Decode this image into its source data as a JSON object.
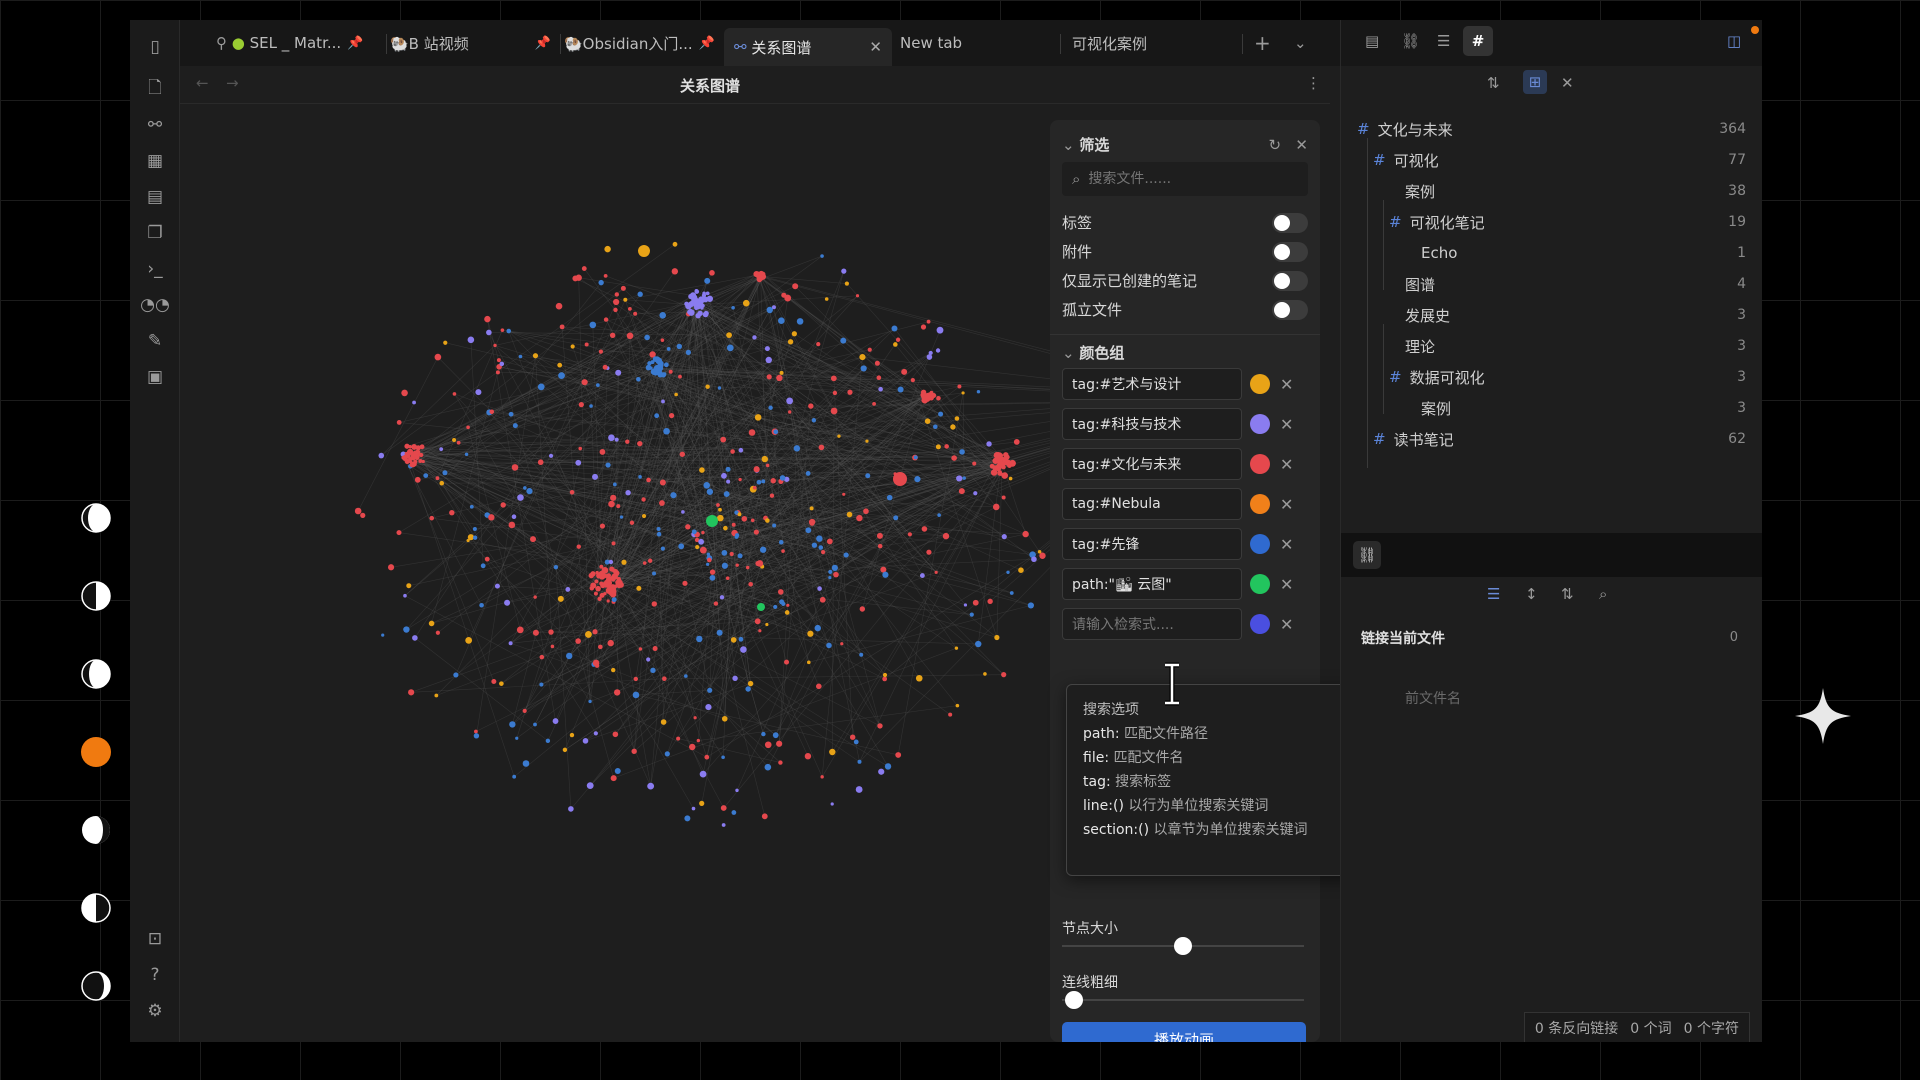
{
  "tabs": [
    {
      "label": "SEL _ Matr...",
      "icon": "kiwi-icon",
      "pinned": true
    },
    {
      "label": "🐏B 站视频",
      "icon": "",
      "pinned": true
    },
    {
      "label": "🐏Obsidian入门...",
      "icon": "",
      "pinned": true
    },
    {
      "label": "关系图谱",
      "icon": "graph-icon",
      "pinned": false,
      "active": true
    },
    {
      "label": "New tab",
      "pinned": false
    },
    {
      "label": "可视化案例",
      "pinned": false
    }
  ],
  "view": {
    "title": "关系图谱"
  },
  "filter": {
    "section_title": "筛选",
    "search_placeholder": "搜索文件......",
    "toggles": [
      {
        "label": "标签",
        "on": false
      },
      {
        "label": "附件",
        "on": false
      },
      {
        "label": "仅显示已创建的笔记",
        "on": false
      },
      {
        "label": "孤立文件",
        "on": false
      }
    ]
  },
  "color_groups": {
    "section_title": "颜色组",
    "groups": [
      {
        "query": "tag:#艺术与设计",
        "color": "#e8a317"
      },
      {
        "query": "tag:#科技与技术",
        "color": "#8a7cf0"
      },
      {
        "query": "tag:#文化与未来",
        "color": "#e5484d"
      },
      {
        "query": "tag:#Nebula",
        "color": "#f0801a"
      },
      {
        "query": "tag:#先锋",
        "color": "#2f6ad0"
      },
      {
        "query": "path:\"🏙 云图\"",
        "color": "#22c55e"
      },
      {
        "query": "",
        "placeholder": "请输入检索式....",
        "color": "#4a4fe0"
      }
    ]
  },
  "search_options": {
    "title": "搜索选项",
    "items": [
      {
        "key": "path:",
        "desc": "匹配文件路径"
      },
      {
        "key": "file:",
        "desc": "匹配文件名"
      },
      {
        "key": "tag:",
        "desc": "搜索标签"
      },
      {
        "key": "line:()",
        "desc": "以行为单位搜索关键词"
      },
      {
        "key": "section:()",
        "desc": "以章节为单位搜索关键词"
      }
    ]
  },
  "display": {
    "node_size_label": "节点大小",
    "node_size_value": 0.5,
    "link_width_label": "连线粗细",
    "link_width_value": 0.05,
    "animate_button": "播放动画"
  },
  "tags_pane": {
    "items": [
      {
        "label": "文化与未来",
        "count": "364",
        "hash": true,
        "level": 0
      },
      {
        "label": "可视化",
        "count": "77",
        "hash": true,
        "level": 1
      },
      {
        "label": "案例",
        "count": "38",
        "hash": false,
        "level": 2
      },
      {
        "label": "可视化笔记",
        "count": "19",
        "hash": true,
        "level": 2
      },
      {
        "label": "Echo",
        "count": "1",
        "hash": false,
        "level": 3
      },
      {
        "label": "图谱",
        "count": "4",
        "hash": false,
        "level": 2
      },
      {
        "label": "发展史",
        "count": "3",
        "hash": false,
        "level": 2
      },
      {
        "label": "理论",
        "count": "3",
        "hash": false,
        "level": 2
      },
      {
        "label": "数据可视化",
        "count": "3",
        "hash": true,
        "level": 2
      },
      {
        "label": "案例",
        "count": "3",
        "hash": false,
        "level": 3
      },
      {
        "label": "读书笔记",
        "count": "62",
        "hash": true,
        "level": 1
      }
    ]
  },
  "backlinks": {
    "title": "链接当前文件",
    "count": "0",
    "placeholder": "前文件名"
  },
  "statusbar": {
    "backlinks": "0 条反向链接",
    "words": "0 个词",
    "chars": "0 个字符"
  }
}
